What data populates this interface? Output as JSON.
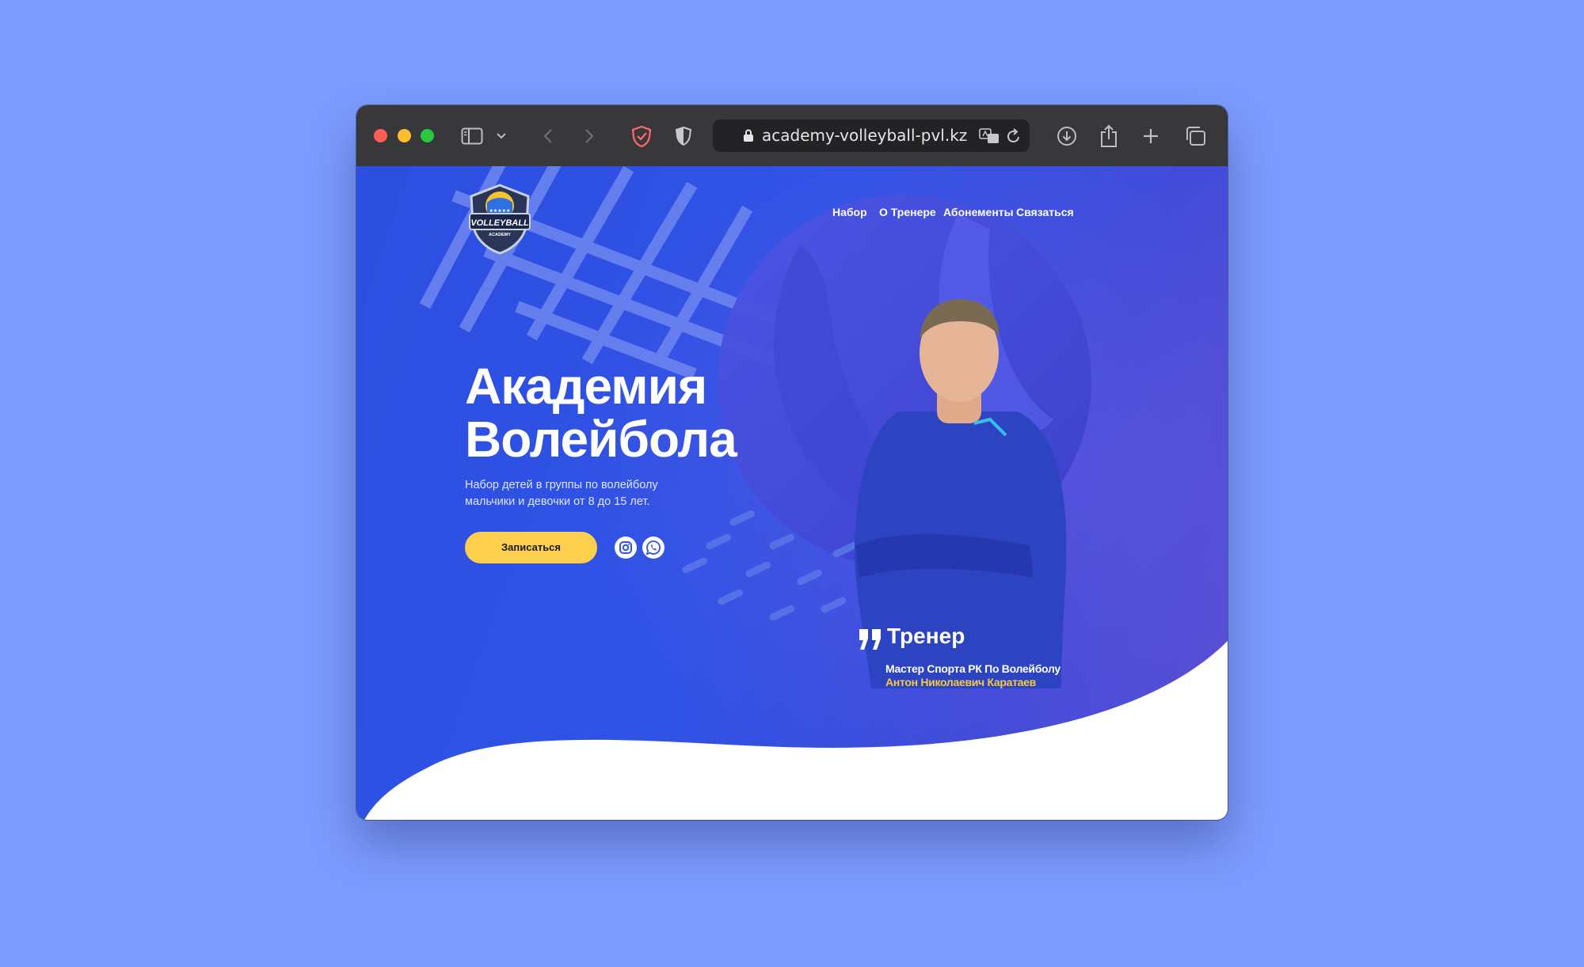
{
  "browser": {
    "url": "academy-volleyball-pvl.kz"
  },
  "logo": {
    "line1": "VOLLEYBALL",
    "line2": "ACADEMY"
  },
  "nav": {
    "items": [
      {
        "label": "Набор"
      },
      {
        "label": "О Тренере"
      },
      {
        "label": "Абонементы"
      },
      {
        "label": "Связаться"
      }
    ]
  },
  "hero": {
    "title_line1": "Академия",
    "title_line2": "Волейбола",
    "subtitle_line1": "Набор детей в группы по волейболу",
    "subtitle_line2": "мальчики и девочки от 8 до 15 лет.",
    "cta_label": "Записаться",
    "social": [
      "instagram-icon",
      "whatsapp-icon"
    ]
  },
  "coach": {
    "heading": "Тренер",
    "rank": "Мастер Спорта РК По Волейболу",
    "name": "Антон Николаевич Каратаев"
  },
  "colors": {
    "page_background": "#7d9cff",
    "hero_blue": "#2f53e6",
    "accent_yellow": "#fcd04c",
    "name_yellow": "#f7c843"
  }
}
